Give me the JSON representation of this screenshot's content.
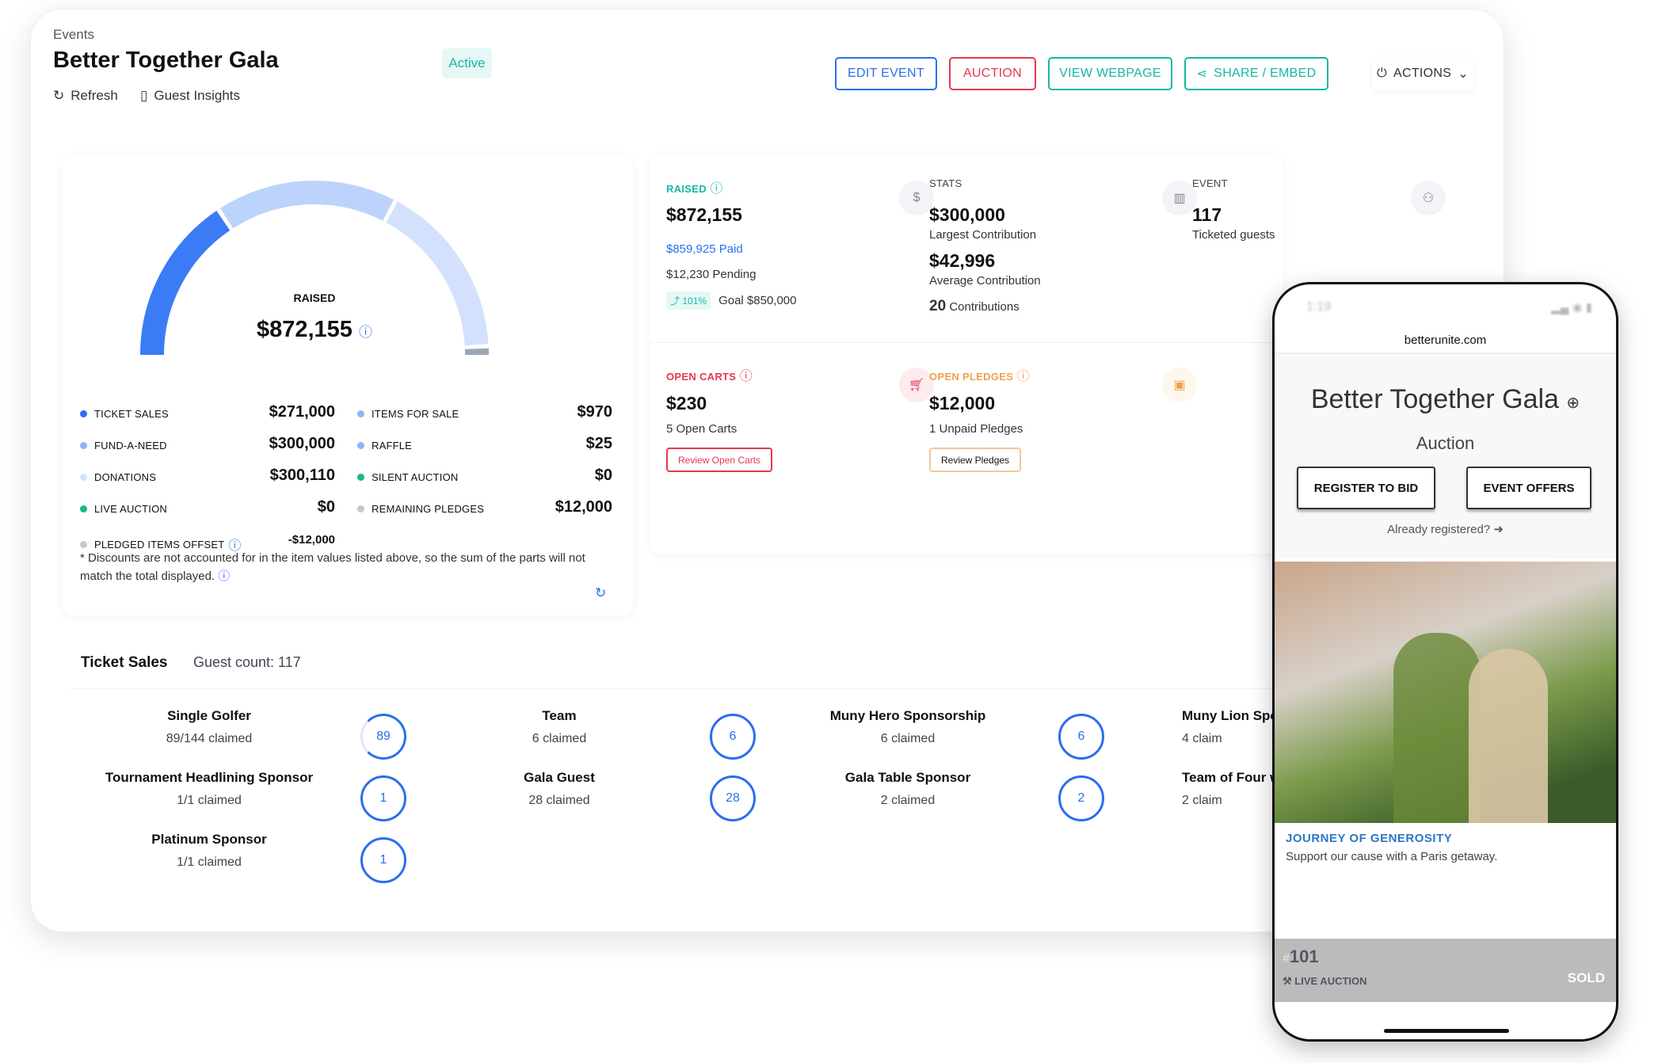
{
  "header": {
    "breadcrumb": "Events",
    "title": "Better Together Gala",
    "status": "Active",
    "refresh": "Refresh",
    "guest_insights": "Guest Insights",
    "buttons": {
      "edit": "EDIT EVENT",
      "auction": "AUCTION",
      "view": "VIEW WEBPAGE",
      "share": "SHARE / EMBED",
      "actions": "ACTIONS"
    }
  },
  "colors": {
    "blue": "#2a6ef0",
    "teal": "#14b8a6",
    "red": "#e5384f",
    "orange": "#f0a04b"
  },
  "gauge": {
    "label": "RAISED",
    "value": "$872,155",
    "segments": [
      {
        "share": 0.31,
        "color": "#3b7bf5"
      },
      {
        "share": 0.34,
        "color": "#bcd3fb"
      },
      {
        "share": 0.33,
        "color": "#d3e1fc"
      },
      {
        "share": 0.02,
        "color": "#9aa5b8"
      }
    ]
  },
  "breakdown": {
    "left": [
      {
        "label": "TICKET SALES",
        "value": "$271,000",
        "color": "#2a6ef0"
      },
      {
        "label": "FUND-A-NEED",
        "value": "$300,000",
        "color": "#8fb4f7"
      },
      {
        "label": "DONATIONS",
        "value": "$300,110",
        "color": "#d4e2fb"
      },
      {
        "label": "LIVE AUCTION",
        "value": "$0",
        "color": "#14b88a"
      },
      {
        "label": "PLEDGED ITEMS OFFSET",
        "value": "-$12,000",
        "color": "#c4c8cf"
      }
    ],
    "right": [
      {
        "label": "ITEMS FOR SALE",
        "value": "$970",
        "color": "#8fb4f7"
      },
      {
        "label": "RAFFLE",
        "value": "$25",
        "color": "#8fb4f7"
      },
      {
        "label": "SILENT AUCTION",
        "value": "$0",
        "color": "#14b88a"
      },
      {
        "label": "REMAINING PLEDGES",
        "value": "$12,000",
        "color": "#c4c8cf"
      }
    ],
    "note": "* Discounts are not accounted for in the item values listed above, so the sum of the parts will not match the total displayed."
  },
  "raised": {
    "label": "RAISED",
    "value": "$872,155",
    "paid": "$859,925 Paid",
    "pending": "$12,230 Pending",
    "pct": "101%",
    "goal": "Goal $850,000"
  },
  "stats": {
    "label": "STATS",
    "largest": "$300,000",
    "largest_label": "Largest Contribution",
    "average": "$42,996",
    "average_label": "Average Contribution",
    "count": "20",
    "count_label": "Contributions"
  },
  "event": {
    "label": "EVENT",
    "guests": "117",
    "guests_label": "Ticketed guests"
  },
  "carts": {
    "label": "OPEN CARTS",
    "value": "$230",
    "sub": "5 Open Carts",
    "button": "Review Open Carts"
  },
  "pledges": {
    "label": "OPEN PLEDGES",
    "value": "$12,000",
    "sub": "1 Unpaid Pledges",
    "button": "Review Pledges"
  },
  "tickets": {
    "title": "Ticket Sales",
    "guest_count": "Guest count: 117",
    "items": [
      {
        "name": "Single Golfer",
        "claimed": "89/144 claimed",
        "count": "89",
        "progress": 0.62
      },
      {
        "name": "Team",
        "claimed": "6 claimed",
        "count": "6",
        "progress": 1
      },
      {
        "name": "Muny Hero Sponsorship",
        "claimed": "6 claimed",
        "count": "6",
        "progress": 1
      },
      {
        "name": "Muny Lion Spo",
        "claimed": "4 claim",
        "count": "",
        "progress": 1
      },
      {
        "name": "Tournament Headlining Sponsor",
        "claimed": "1/1 claimed",
        "count": "1",
        "progress": 1
      },
      {
        "name": "Gala Guest",
        "claimed": "28 claimed",
        "count": "28",
        "progress": 1
      },
      {
        "name": "Gala Table Sponsor",
        "claimed": "2 claimed",
        "count": "2",
        "progress": 1
      },
      {
        "name": "Team of Four wit",
        "claimed": "2 claim",
        "count": "",
        "progress": 1
      },
      {
        "name": "Platinum Sponsor",
        "claimed": "1/1 claimed",
        "count": "1",
        "progress": 1
      }
    ]
  },
  "phone": {
    "time": "1:19",
    "url": "betterunite.com",
    "title": "Better Together Gala",
    "subtitle": "Auction",
    "register": "REGISTER TO BID",
    "offers": "EVENT OFFERS",
    "already": "Already registered?",
    "item_title": "JOURNEY OF GENEROSITY",
    "item_desc": "Support our cause with a Paris getaway.",
    "item_hash": "#",
    "item_number": "101",
    "item_type": "LIVE AUCTION",
    "item_status": "SOLD"
  }
}
